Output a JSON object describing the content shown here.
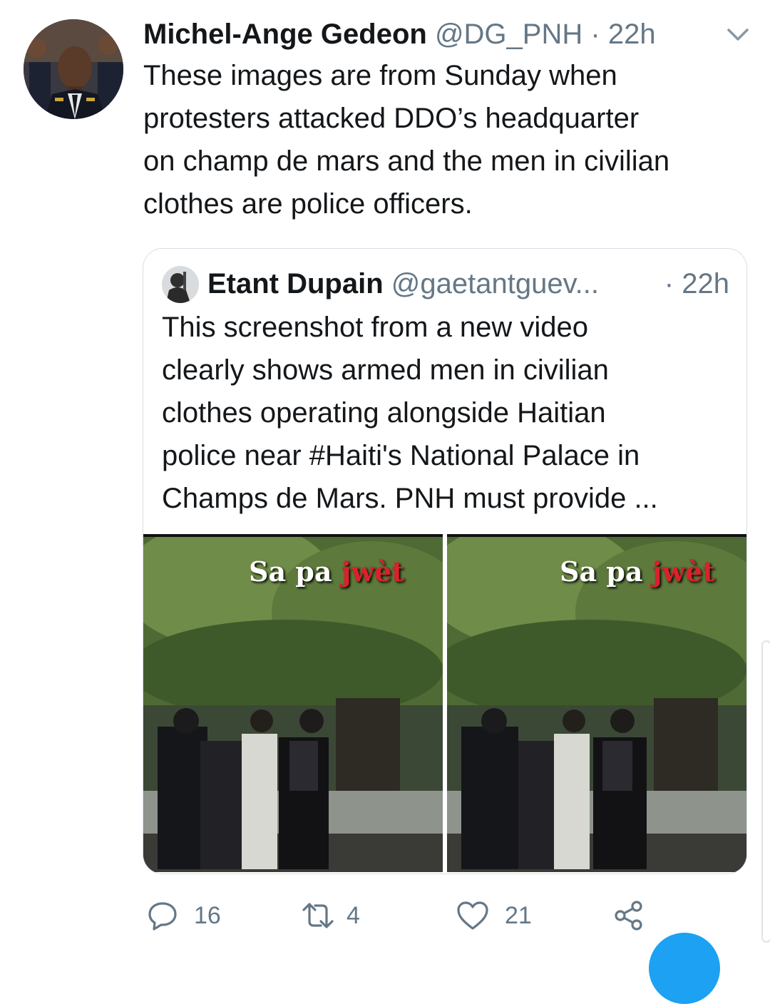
{
  "tweet": {
    "author_name": "Michel-Ange Gedeon",
    "author_handle": "@DG_PNH",
    "separator": "·",
    "time": "22h",
    "text_lines": [
      "These images are from Sunday when",
      "protesters attacked DDO’s headquarter",
      "on champ de mars and the men in civilian",
      "clothes are police officers."
    ]
  },
  "quoted_tweet": {
    "author_name": "Etant Dupain",
    "author_handle": "@gaetantguev...",
    "separator": "·",
    "time": "22h",
    "text_lines": [
      "This screenshot from a new video",
      "clearly shows armed men in civilian",
      "clothes operating alongside Haitian",
      "police near #Haiti's National Palace in",
      "Champs de Mars. PNH must provide ..."
    ],
    "media": [
      {
        "overlay_white": "Sa pa",
        "overlay_red": "jwèt"
      },
      {
        "overlay_white": "Sa pa",
        "overlay_red": "jwèt"
      }
    ]
  },
  "actions": {
    "replies": "16",
    "retweets": "4",
    "likes": "21"
  },
  "colors": {
    "text": "#14171a",
    "secondary": "#657786",
    "border": "#d6dfe6",
    "accent": "#1da1f2"
  },
  "icons": [
    "chevron-down-icon",
    "reply-icon",
    "retweet-icon",
    "like-icon",
    "share-icon"
  ]
}
